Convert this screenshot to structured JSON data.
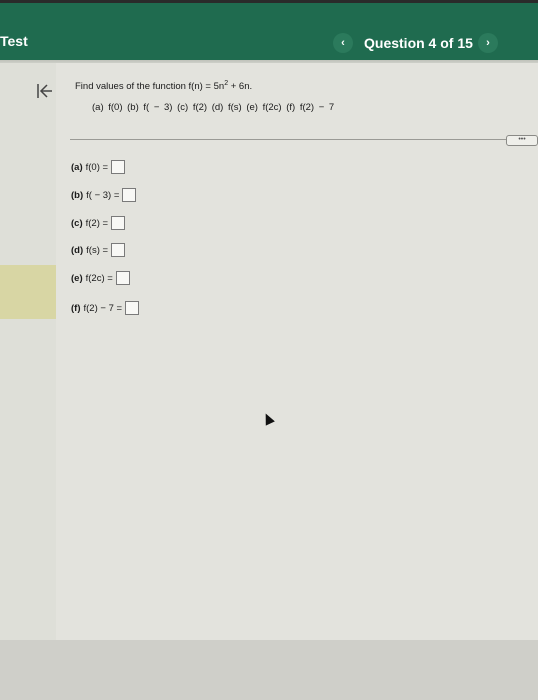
{
  "header": {
    "title": "Test",
    "question_counter": "Question 4 of 15",
    "prev_glyph": "‹",
    "next_glyph": "›",
    "bg_color": "#1f6b4f"
  },
  "question": {
    "prompt_prefix": "Find values of the function f(n) = 5n",
    "prompt_exponent": "2",
    "prompt_suffix": " + 6n.",
    "parts": "(a) f(0)   (b) f( − 3)   (c) f(2)   (d) f(s)   (e) f(2c)   (f) f(2) − 7"
  },
  "more_button": "•••",
  "answers": [
    {
      "label": "(a)",
      "expr": "f(0) ="
    },
    {
      "label": "(b)",
      "expr": "f( − 3) ="
    },
    {
      "label": "(c)",
      "expr": "f(2) ="
    },
    {
      "label": "(d)",
      "expr": "f(s) ="
    },
    {
      "label": "(e)",
      "expr": "f(2c) ="
    },
    {
      "label": "(f)",
      "expr": "f(2) − 7 ="
    }
  ],
  "icons": {
    "collapse": "collapse-left-icon",
    "prev": "chevron-left-icon",
    "next": "chevron-right-icon"
  }
}
